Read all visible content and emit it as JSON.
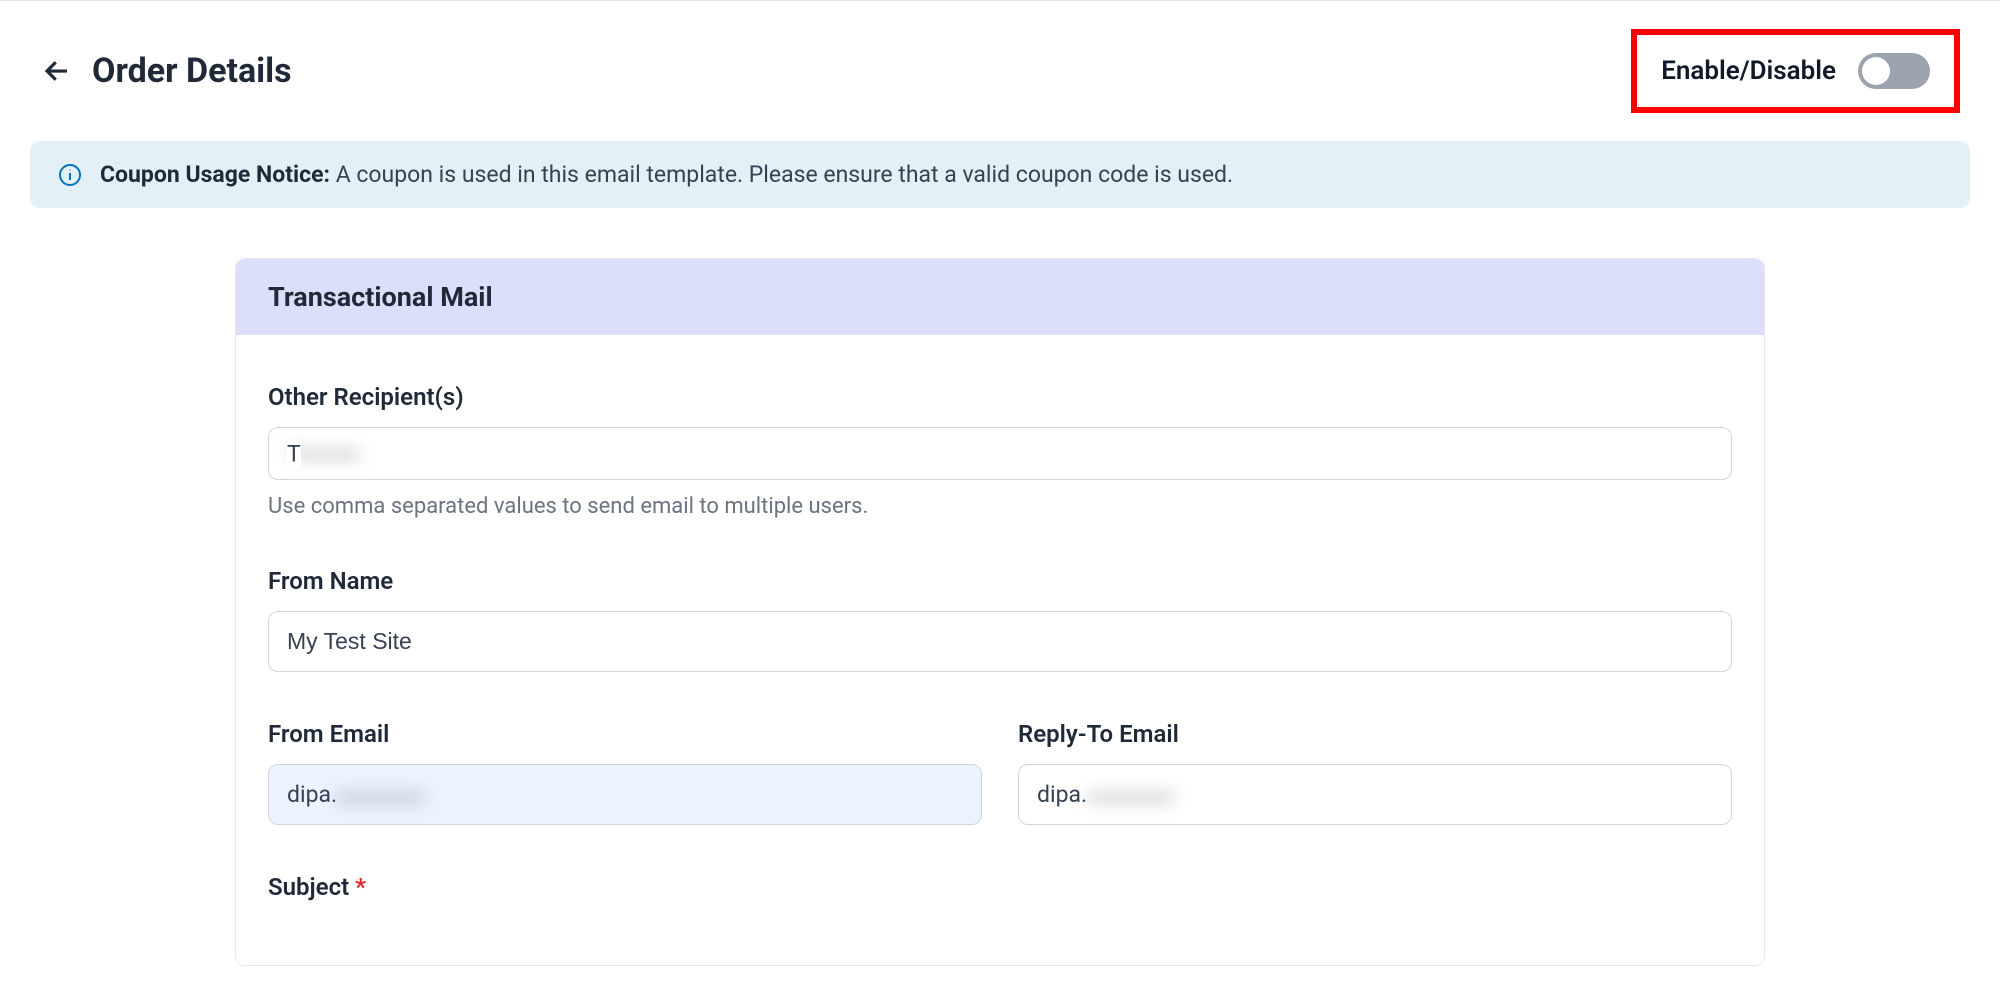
{
  "header": {
    "title": "Order Details",
    "toggle_label": "Enable/Disable",
    "enabled": false
  },
  "notice": {
    "title": "Coupon Usage Notice:",
    "body": "A coupon is used in this email template. Please ensure that a valid coupon code is used."
  },
  "card": {
    "title": "Transactional Mail",
    "fields": {
      "other_recipients": {
        "label": "Other Recipient(s)",
        "value": "T",
        "help": "Use comma separated values to send email to multiple users."
      },
      "from_name": {
        "label": "From Name",
        "value": "My Test Site"
      },
      "from_email": {
        "label": "From Email",
        "prefix": "dipa.",
        "blurred": "xxxxxxxxxxx"
      },
      "reply_to_email": {
        "label": "Reply-To Email",
        "prefix": "dipa.",
        "blurred": "xxxxxxxxxxx"
      },
      "subject": {
        "label": "Subject",
        "required_mark": "*"
      }
    }
  }
}
